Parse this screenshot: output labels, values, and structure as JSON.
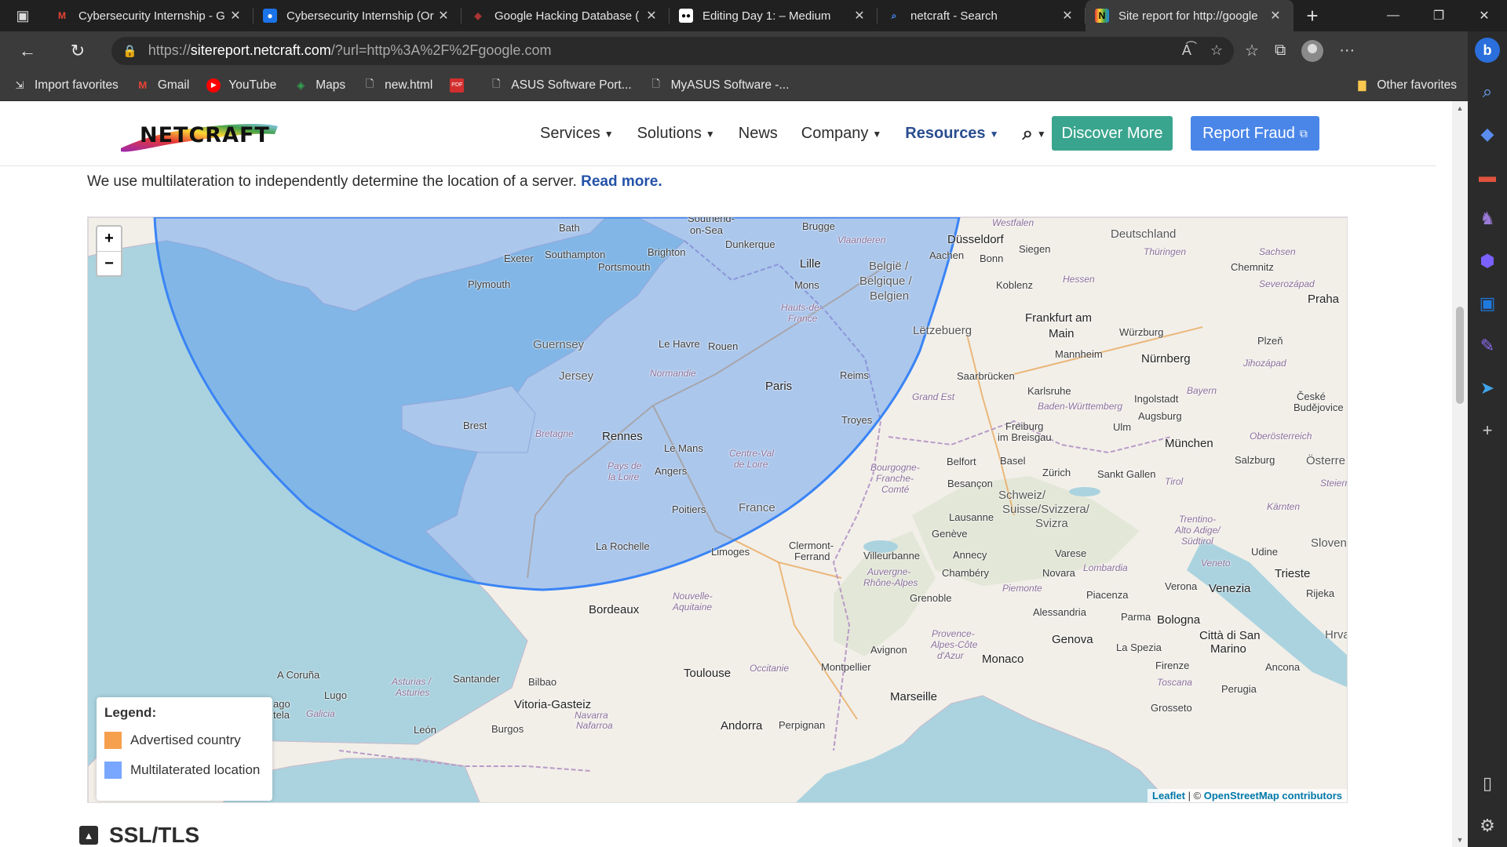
{
  "browser": {
    "tabs": [
      {
        "title": "Cybersecurity Internship - G",
        "favicon": "gmail-icon",
        "active": false
      },
      {
        "title": "Cybersecurity Internship (Or",
        "favicon": "contacts-icon",
        "active": false
      },
      {
        "title": "Google Hacking Database (",
        "favicon": "exploit-db-icon",
        "active": false
      },
      {
        "title": "Editing Day 1: – Medium",
        "favicon": "medium-icon",
        "active": false
      },
      {
        "title": "netcraft - Search",
        "favicon": "search-icon",
        "active": false
      },
      {
        "title": "Site report for http://google",
        "favicon": "netcraft-icon",
        "active": true
      }
    ],
    "address": {
      "scheme": "https://",
      "host": "sitereport.netcraft.com",
      "path": "/?url=http%3A%2F%2Fgoogle.com"
    },
    "bookmarks": [
      {
        "label": "Import favorites",
        "icon": "import-icon"
      },
      {
        "label": "Gmail",
        "icon": "gmail-icon"
      },
      {
        "label": "YouTube",
        "icon": "youtube-icon"
      },
      {
        "label": "Maps",
        "icon": "maps-icon"
      },
      {
        "label": "new.html",
        "icon": "file-icon"
      },
      {
        "label": "",
        "icon": "pdf-icon"
      },
      {
        "label": "ASUS Software Port...",
        "icon": "file-icon"
      },
      {
        "label": "MyASUS Software -...",
        "icon": "file-icon"
      }
    ],
    "other_favorites": "Other favorites"
  },
  "site": {
    "nav": {
      "services": "Services",
      "solutions": "Solutions",
      "news": "News",
      "company": "Company",
      "resources": "Resources",
      "discover": "Discover More",
      "report_fraud": "Report Fraud"
    },
    "intro_text": "We use multilateration to independently determine the location of a server.",
    "read_more": "Read more.",
    "map": {
      "zoom_in": "+",
      "zoom_out": "−",
      "legend_title": "Legend:",
      "legend_items": [
        {
          "label": "Advertised country",
          "color": "#f6a04d"
        },
        {
          "label": "Multilaterated location",
          "color": "#79a7ff"
        }
      ],
      "attribution_leaflet": "Leaflet",
      "attribution_sep": " | © ",
      "attribution_osm": "OpenStreetMap contributors",
      "places": {
        "bath": "Bath",
        "southend": "Southend-",
        "on_sea": "on-Sea",
        "brugge": "Brugge",
        "dusseldorf": "Düsseldorf",
        "westfalen": "Westfalen",
        "deutschland": "Deutschland",
        "exeter": "Exeter",
        "southampton": "Southampton",
        "brighton": "Brighton",
        "dunkerque": "Dunkerque",
        "vlaanderen": "Vlaanderen",
        "aachen": "Aachen",
        "bonn": "Bonn",
        "siegen": "Siegen",
        "thuringen": "Thüringen",
        "sachsen": "Sachsen",
        "portsmouth": "Portsmouth",
        "lille": "Lille",
        "belgie": "België /",
        "belgique": "Belgique /",
        "belgien": "Belgien",
        "chemnitz": "Chemnitz",
        "plymouth": "Plymouth",
        "mons": "Mons",
        "koblenz": "Koblenz",
        "hessen": "Hessen",
        "severozapad": "Severozápad",
        "praha": "Praha",
        "hauts": "Hauts-de-",
        "france_region": "France",
        "frankfurt": "Frankfurt am",
        "main": "Main",
        "guernsey": "Guernsey",
        "le_havre": "Le Havre",
        "rouen": "Rouen",
        "letzebuerg": "Lëtzebuerg",
        "wurzburg": "Würzburg",
        "plzen": "Plzeň",
        "jersey": "Jersey",
        "normandie": "Normandie",
        "mannheim": "Mannheim",
        "nurnberg": "Nürnberg",
        "jihozapad": "Jihozápad",
        "paris": "Paris",
        "reims": "Reims",
        "saarbrucken": "Saarbrücken",
        "karlsruhe": "Karlsruhe",
        "bayern": "Bayern",
        "ingolstadt": "Ingolstadt",
        "ceske": "České",
        "budejovice": "Budějovice",
        "grand_est": "Grand Est",
        "baden": "Baden-Württemberg",
        "augsburg": "Augsburg",
        "brest": "Brest",
        "troyes": "Troyes",
        "freiburg": "Freiburg",
        "im_breisgau": "im Breisgau",
        "ulm": "Ulm",
        "bretagne": "Bretagne",
        "rennes": "Rennes",
        "oberosterreich": "Oberösterreich",
        "munchen": "München",
        "le_mans": "Le Mans",
        "centre": "Centre-Val",
        "de_loire": "de Loire",
        "belfort": "Belfort",
        "basel": "Basel",
        "salzburg": "Salzburg",
        "osterre": "Österre",
        "pays": "Pays de",
        "la_loire": "la Loire",
        "angers": "Angers",
        "bourgogne": "Bourgogne-",
        "franche": "Franche-",
        "comte": "Comté",
        "besancon": "Besançon",
        "zurich": "Zürich",
        "sankt_gallen": "Sankt Gallen",
        "tirol": "Tirol",
        "steiern": "Steiern",
        "schweiz": "Schweiz/",
        "suisse": "Suisse/Svizzera/",
        "svizra": "Svizra",
        "kamten": "Kärnten",
        "france": "France",
        "poitiers": "Poitiers",
        "lausanne": "Lausanne",
        "trentino": "Trentino-",
        "alto_adige": "Alto Adige/",
        "sudtirol": "Südtirol",
        "geneve": "Genève",
        "slovenij": "Slovenij",
        "la_rochelle": "La Rochelle",
        "clermont": "Clermont-",
        "ferrand": "Ferrand",
        "limoges": "Limoges",
        "villeurbanne": "Villeurbanne",
        "annecy": "Annecy",
        "varese": "Varese",
        "udine": "Udine",
        "veneto": "Veneto",
        "trieste": "Trieste",
        "chambery": "Chambéry",
        "lombardia": "Lombardia",
        "auvergne": "Auvergne-",
        "rhone_alpes": "Rhône-Alpes",
        "novara": "Novara",
        "verona": "Verona",
        "venezia": "Venezia",
        "rijeka": "Rijeka",
        "piemonte": "Piemonte",
        "piacenza": "Piacenza",
        "nouvelle": "Nouvelle-",
        "aquitaine": "Aquitaine",
        "grenoble": "Grenoble",
        "bordeaux": "Bordeaux",
        "alessandria": "Alessandria",
        "parma": "Parma",
        "bologna": "Bologna",
        "hrva": "Hrva",
        "provence": "Provence-",
        "alpes_cote": "Alpes-Côte",
        "d_azur": "d'Azur",
        "genova": "Genova",
        "citta": "Città di San",
        "marino": "Marino",
        "avignon": "Avignon",
        "la_spezia": "La Spezia",
        "monaco": "Monaco",
        "a_coruna": "A Coruña",
        "montpellier": "Montpellier",
        "occitanie": "Occitanie",
        "firenze": "Firenze",
        "ancona": "Ancona",
        "toulouse": "Toulouse",
        "santander": "Santander",
        "asturias1": "Asturias /",
        "asturias2": "Asturies",
        "bilbao": "Bilbao",
        "lugo": "Lugo",
        "toscana": "Toscana",
        "perugia": "Perugia",
        "marseille": "Marseille",
        "ago": "ago",
        "tela": "tela",
        "galicia": "Galicia",
        "vitoria": "Vitoria-Gasteiz",
        "navarra": "Navarra",
        "nafarroa": "Nafarroa",
        "grosseto": "Grosseto",
        "andorra": "Andorra",
        "perpignan": "Perpignan",
        "burgos": "Burgos",
        "leon": "León"
      }
    },
    "ssl_heading": "SSL/TLS"
  }
}
